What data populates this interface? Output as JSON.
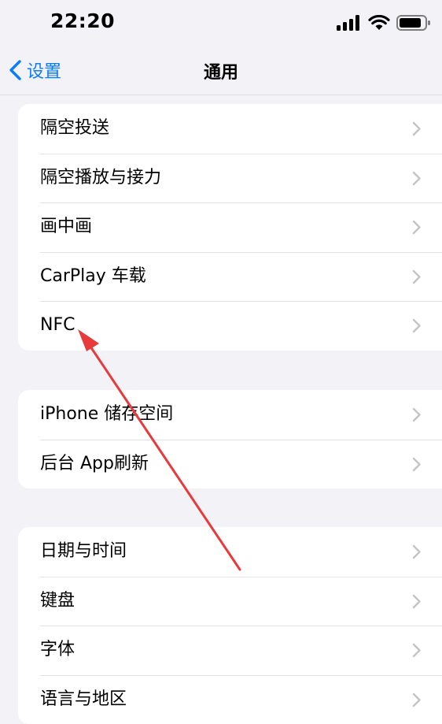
{
  "status_bar": {
    "time": "22:20",
    "icons": [
      "signal-icon",
      "wifi-icon",
      "battery-icon"
    ]
  },
  "nav": {
    "back_label": "设置",
    "title": "通用"
  },
  "groups": [
    {
      "items": [
        {
          "label": "隔空投送"
        },
        {
          "label": "隔空播放与接力"
        },
        {
          "label": "画中画"
        },
        {
          "label": "CarPlay 车载"
        },
        {
          "label": "NFC"
        }
      ]
    },
    {
      "items": [
        {
          "label": "iPhone 储存空间"
        },
        {
          "label": "后台 App刷新"
        }
      ]
    },
    {
      "items": [
        {
          "label": "日期与时间"
        },
        {
          "label": "键盘"
        },
        {
          "label": "字体"
        },
        {
          "label": "语言与地区"
        }
      ]
    }
  ],
  "colors": {
    "accent": "#0a7cff",
    "background": "#f2f2f7",
    "annotation_arrow": "#e8393c",
    "chevron": "#c4c4c7"
  }
}
